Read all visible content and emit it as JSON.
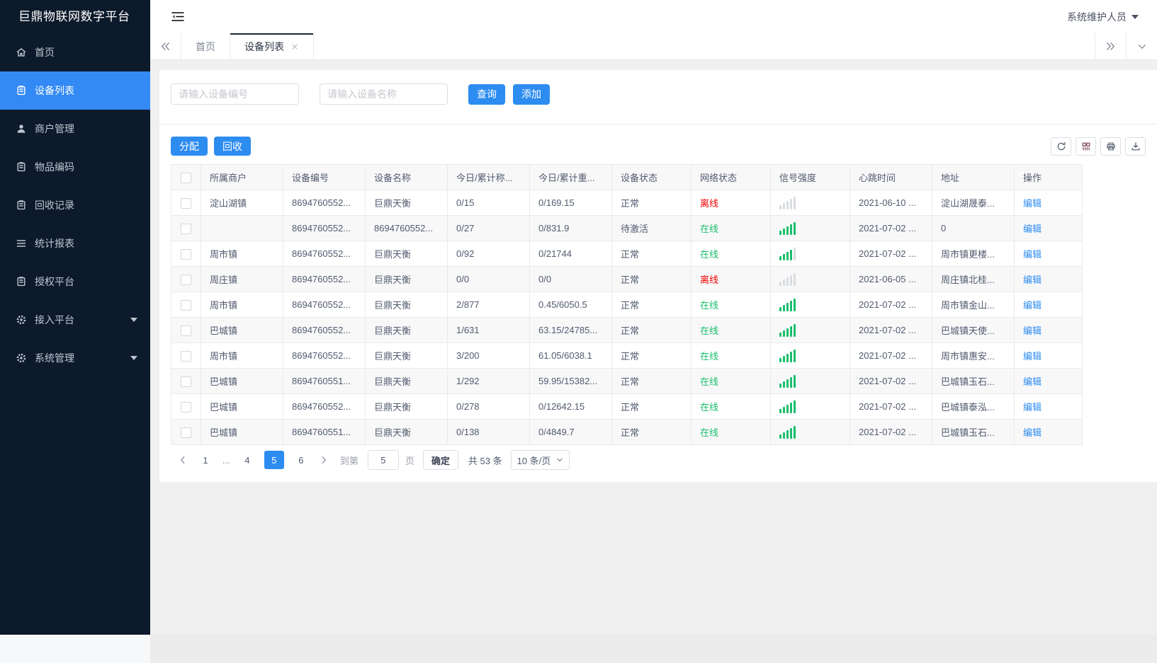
{
  "colors": {
    "accent": "#2d8cf0",
    "online_green": "#19be6b",
    "offline_red": "#f40000",
    "sidebar_bg": "#0d1a2b",
    "sidebar_active": "#338af5"
  },
  "sidebar": {
    "title": "巨鼎物联网数字平台",
    "items": [
      {
        "id": "home",
        "label": "首页",
        "icon": "home-icon",
        "active": false,
        "expandable": false
      },
      {
        "id": "device-list",
        "label": "设备列表",
        "icon": "doc-icon",
        "active": true,
        "expandable": false
      },
      {
        "id": "merchant-mgmt",
        "label": "商户管理",
        "icon": "user-icon",
        "active": false,
        "expandable": false
      },
      {
        "id": "item-code",
        "label": "物品编码",
        "icon": "doc-icon",
        "active": false,
        "expandable": false
      },
      {
        "id": "recycle-record",
        "label": "回收记录",
        "icon": "doc-icon",
        "active": false,
        "expandable": false
      },
      {
        "id": "stats-report",
        "label": "统计报表",
        "icon": "menu-icon",
        "active": false,
        "expandable": false
      },
      {
        "id": "auth-platform",
        "label": "授权平台",
        "icon": "doc-icon",
        "active": false,
        "expandable": false
      },
      {
        "id": "access-platform",
        "label": "接入平台",
        "icon": "gear-icon",
        "active": false,
        "expandable": true
      },
      {
        "id": "system-mgmt",
        "label": "系统管理",
        "icon": "gear-icon",
        "active": false,
        "expandable": true
      }
    ]
  },
  "topbar": {
    "user_name": "系统维护人员",
    "collapse_icon": "collapse-icon",
    "user_caret_icon": "caret-down-icon"
  },
  "tabbar": {
    "tabs": [
      {
        "id": "home",
        "label": "首页",
        "active": false,
        "closable": false
      },
      {
        "id": "device-list",
        "label": "设备列表",
        "active": true,
        "closable": true
      }
    ],
    "left_icon": "chevron-double-left-icon",
    "right_icon": "chevron-double-right-icon",
    "menu_icon": "chevron-down-icon"
  },
  "search": {
    "device_no_placeholder": "请输入设备编号",
    "device_name_placeholder": "请输入设备名称",
    "query_label": "查询",
    "add_label": "添加"
  },
  "table_toolbar": {
    "assign_label": "分配",
    "recycle_label": "回收",
    "icon_buttons": [
      "refresh-icon",
      "columns-icon",
      "printer-icon",
      "download-icon"
    ]
  },
  "table": {
    "columns": [
      "所属商户",
      "设备编号",
      "设备名称",
      "今日/累计称...",
      "今日/累计重...",
      "设备状态",
      "网络状态",
      "信号强度",
      "心跳时间",
      "地址",
      "操作"
    ],
    "edit_label": "编辑",
    "rows": [
      {
        "merchant": "淀山湖镇",
        "device_no": "8694760552...",
        "device_name": "巨鼎天衡",
        "today_count": "0/15",
        "today_weight": "0/169.15",
        "status": "正常",
        "network": "离线",
        "online": false,
        "signal": 0,
        "heartbeat": "2021-06-10 ...",
        "address": "淀山湖晟泰..."
      },
      {
        "merchant": "",
        "device_no": "8694760552...",
        "device_name": "8694760552...",
        "today_count": "0/27",
        "today_weight": "0/831.9",
        "status": "待激活",
        "network": "在线",
        "online": true,
        "signal": 5,
        "heartbeat": "2021-07-02 ...",
        "address": "0"
      },
      {
        "merchant": "周市镇",
        "device_no": "8694760552...",
        "device_name": "巨鼎天衡",
        "today_count": "0/92",
        "today_weight": "0/21744",
        "status": "正常",
        "network": "在线",
        "online": true,
        "signal": 4,
        "heartbeat": "2021-07-02 ...",
        "address": "周市镇更楼..."
      },
      {
        "merchant": "周庄镇",
        "device_no": "8694760552...",
        "device_name": "巨鼎天衡",
        "today_count": "0/0",
        "today_weight": "0/0",
        "status": "正常",
        "network": "离线",
        "online": false,
        "signal": 0,
        "heartbeat": "2021-06-05 ...",
        "address": "周庄镇北桂..."
      },
      {
        "merchant": "周市镇",
        "device_no": "8694760552...",
        "device_name": "巨鼎天衡",
        "today_count": "2/877",
        "today_weight": "0.45/6050.5",
        "status": "正常",
        "network": "在线",
        "online": true,
        "signal": 5,
        "heartbeat": "2021-07-02 ...",
        "address": "周市镇金山..."
      },
      {
        "merchant": "巴城镇",
        "device_no": "8694760552...",
        "device_name": "巨鼎天衡",
        "today_count": "1/631",
        "today_weight": "63.15/24785...",
        "status": "正常",
        "network": "在线",
        "online": true,
        "signal": 5,
        "heartbeat": "2021-07-02 ...",
        "address": "巴城镇天使..."
      },
      {
        "merchant": "周市镇",
        "device_no": "8694760552...",
        "device_name": "巨鼎天衡",
        "today_count": "3/200",
        "today_weight": "61.05/6038.1",
        "status": "正常",
        "network": "在线",
        "online": true,
        "signal": 5,
        "heartbeat": "2021-07-02 ...",
        "address": "周市镇惠安..."
      },
      {
        "merchant": "巴城镇",
        "device_no": "8694760551...",
        "device_name": "巨鼎天衡",
        "today_count": "1/292",
        "today_weight": "59.95/15382...",
        "status": "正常",
        "network": "在线",
        "online": true,
        "signal": 5,
        "heartbeat": "2021-07-02 ...",
        "address": "巴城镇玉石..."
      },
      {
        "merchant": "巴城镇",
        "device_no": "8694760552...",
        "device_name": "巨鼎天衡",
        "today_count": "0/278",
        "today_weight": "0/12642.15",
        "status": "正常",
        "network": "在线",
        "online": true,
        "signal": 5,
        "heartbeat": "2021-07-02 ...",
        "address": "巴城镇泰泓..."
      },
      {
        "merchant": "巴城镇",
        "device_no": "8694760551...",
        "device_name": "巨鼎天衡",
        "today_count": "0/138",
        "today_weight": "0/4849.7",
        "status": "正常",
        "network": "在线",
        "online": true,
        "signal": 5,
        "heartbeat": "2021-07-02 ...",
        "address": "巴城镇玉石..."
      }
    ]
  },
  "pagination": {
    "pages": [
      {
        "label": "1",
        "active": false,
        "ellipsis": false
      },
      {
        "label": "...",
        "active": false,
        "ellipsis": true
      },
      {
        "label": "4",
        "active": false,
        "ellipsis": false
      },
      {
        "label": "5",
        "active": true,
        "ellipsis": false
      },
      {
        "label": "6",
        "active": false,
        "ellipsis": false
      }
    ],
    "goto_label": "到第",
    "goto_value": "5",
    "page_word": "页",
    "confirm_label": "确定",
    "total_label": "共 53 条",
    "page_size_label": "10 条/页"
  }
}
